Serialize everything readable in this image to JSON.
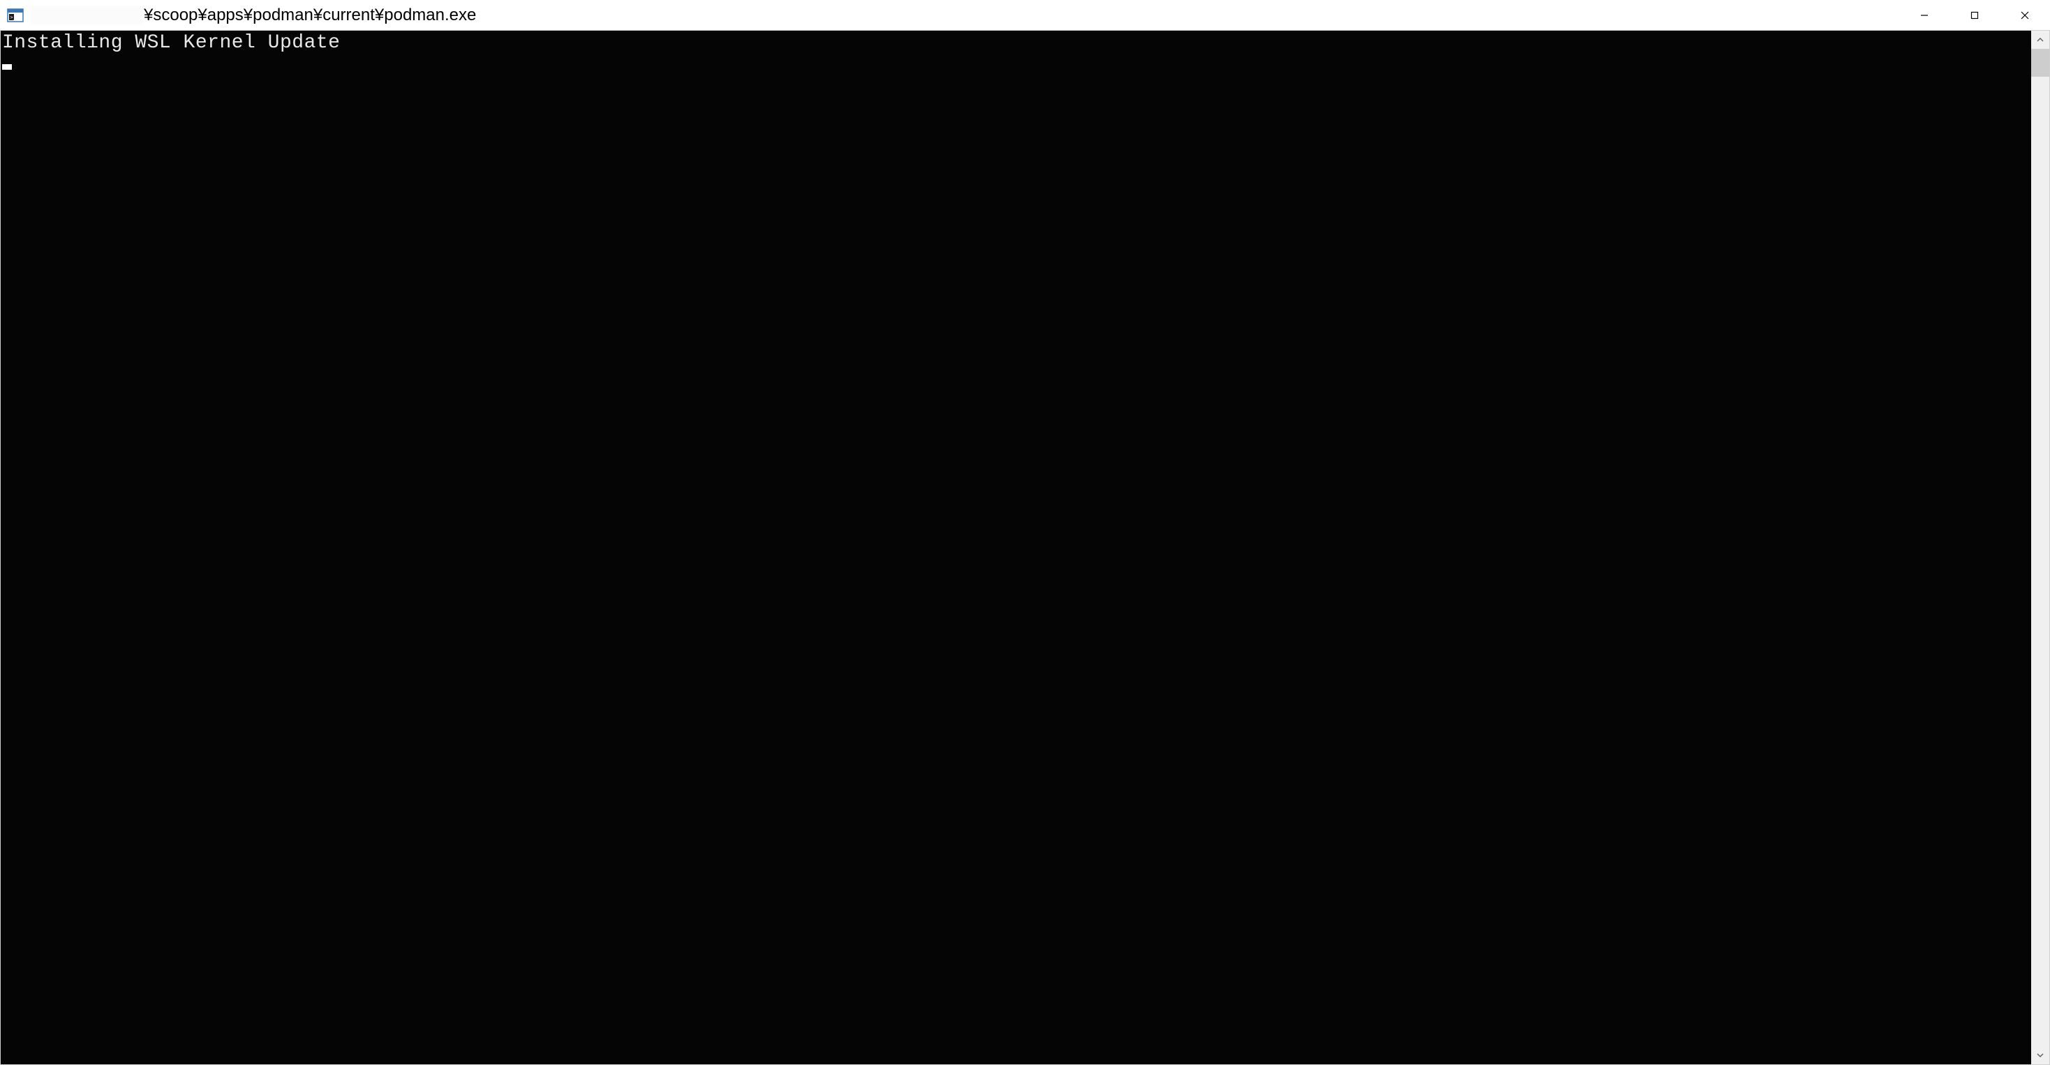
{
  "window": {
    "title_path": "¥scoop¥apps¥podman¥current¥podman.exe",
    "controls": {
      "minimize": "minimize",
      "maximize": "maximize",
      "close": "close"
    }
  },
  "terminal": {
    "lines": [
      "Installing WSL Kernel Update"
    ]
  }
}
